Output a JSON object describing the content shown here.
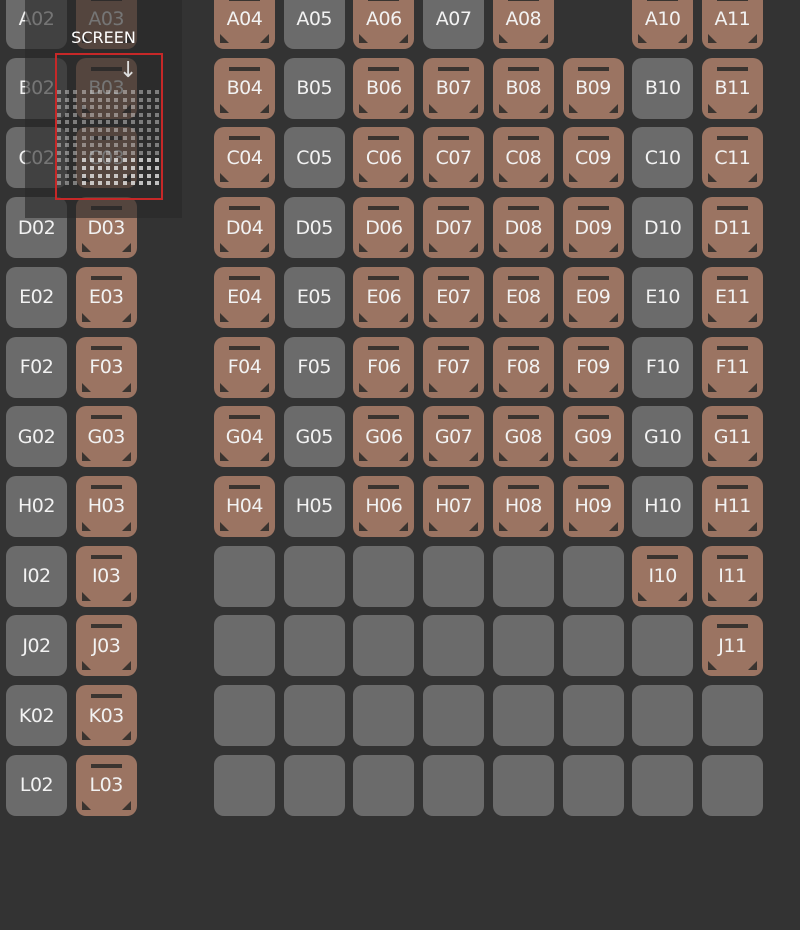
{
  "colors": {
    "background": "#333333",
    "available": "#6b6b6b",
    "booked": "#9b7462",
    "viewport_border": "#c62828"
  },
  "minimap": {
    "screen_label": "SCREEN",
    "arrow_icon": "arrow-down-icon"
  },
  "rows": [
    {
      "row": "A",
      "seats": [
        [
          "A02",
          "available"
        ],
        [
          "A03",
          "booked"
        ],
        [
          "A04",
          "booked"
        ],
        [
          "A05",
          "available"
        ],
        [
          "A06",
          "booked"
        ],
        [
          "A07",
          "available"
        ],
        [
          "A08",
          "booked"
        ],
        [
          "",
          "gap"
        ],
        [
          "A10",
          "booked"
        ],
        [
          "A11",
          "booked"
        ]
      ]
    },
    {
      "row": "B",
      "seats": [
        [
          "B02",
          "available"
        ],
        [
          "B03",
          "booked"
        ],
        [
          "B04",
          "booked"
        ],
        [
          "B05",
          "available"
        ],
        [
          "B06",
          "booked"
        ],
        [
          "B07",
          "booked"
        ],
        [
          "B08",
          "booked"
        ],
        [
          "B09",
          "booked"
        ],
        [
          "B10",
          "available"
        ],
        [
          "B11",
          "booked"
        ]
      ]
    },
    {
      "row": "C",
      "seats": [
        [
          "C02",
          "available"
        ],
        [
          "C03",
          "booked"
        ],
        [
          "C04",
          "booked"
        ],
        [
          "C05",
          "available"
        ],
        [
          "C06",
          "booked"
        ],
        [
          "C07",
          "booked"
        ],
        [
          "C08",
          "booked"
        ],
        [
          "C09",
          "booked"
        ],
        [
          "C10",
          "available"
        ],
        [
          "C11",
          "booked"
        ]
      ]
    },
    {
      "row": "D",
      "seats": [
        [
          "D02",
          "available"
        ],
        [
          "D03",
          "booked"
        ],
        [
          "D04",
          "booked"
        ],
        [
          "D05",
          "available"
        ],
        [
          "D06",
          "booked"
        ],
        [
          "D07",
          "booked"
        ],
        [
          "D08",
          "booked"
        ],
        [
          "D09",
          "booked"
        ],
        [
          "D10",
          "available"
        ],
        [
          "D11",
          "booked"
        ]
      ]
    },
    {
      "row": "E",
      "seats": [
        [
          "E02",
          "available"
        ],
        [
          "E03",
          "booked"
        ],
        [
          "E04",
          "booked"
        ],
        [
          "E05",
          "available"
        ],
        [
          "E06",
          "booked"
        ],
        [
          "E07",
          "booked"
        ],
        [
          "E08",
          "booked"
        ],
        [
          "E09",
          "booked"
        ],
        [
          "E10",
          "available"
        ],
        [
          "E11",
          "booked"
        ]
      ]
    },
    {
      "row": "F",
      "seats": [
        [
          "F02",
          "available"
        ],
        [
          "F03",
          "booked"
        ],
        [
          "F04",
          "booked"
        ],
        [
          "F05",
          "available"
        ],
        [
          "F06",
          "booked"
        ],
        [
          "F07",
          "booked"
        ],
        [
          "F08",
          "booked"
        ],
        [
          "F09",
          "booked"
        ],
        [
          "F10",
          "available"
        ],
        [
          "F11",
          "booked"
        ]
      ]
    },
    {
      "row": "G",
      "seats": [
        [
          "G02",
          "available"
        ],
        [
          "G03",
          "booked"
        ],
        [
          "G04",
          "booked"
        ],
        [
          "G05",
          "available"
        ],
        [
          "G06",
          "booked"
        ],
        [
          "G07",
          "booked"
        ],
        [
          "G08",
          "booked"
        ],
        [
          "G09",
          "booked"
        ],
        [
          "G10",
          "available"
        ],
        [
          "G11",
          "booked"
        ]
      ]
    },
    {
      "row": "H",
      "seats": [
        [
          "H02",
          "available"
        ],
        [
          "H03",
          "booked"
        ],
        [
          "H04",
          "booked"
        ],
        [
          "H05",
          "available"
        ],
        [
          "H06",
          "booked"
        ],
        [
          "H07",
          "booked"
        ],
        [
          "H08",
          "booked"
        ],
        [
          "H09",
          "booked"
        ],
        [
          "H10",
          "available"
        ],
        [
          "H11",
          "booked"
        ]
      ]
    },
    {
      "row": "I",
      "seats": [
        [
          "I02",
          "available"
        ],
        [
          "I03",
          "booked"
        ],
        [
          "",
          "empty"
        ],
        [
          "",
          "empty"
        ],
        [
          "",
          "empty"
        ],
        [
          "",
          "empty"
        ],
        [
          "",
          "empty"
        ],
        [
          "",
          "empty"
        ],
        [
          "I10",
          "booked"
        ],
        [
          "I11",
          "booked"
        ]
      ]
    },
    {
      "row": "J",
      "seats": [
        [
          "J02",
          "available"
        ],
        [
          "J03",
          "booked"
        ],
        [
          "",
          "empty"
        ],
        [
          "",
          "empty"
        ],
        [
          "",
          "empty"
        ],
        [
          "",
          "empty"
        ],
        [
          "",
          "empty"
        ],
        [
          "",
          "empty"
        ],
        [
          "",
          "empty"
        ],
        [
          "J11",
          "booked"
        ]
      ]
    },
    {
      "row": "K",
      "seats": [
        [
          "K02",
          "available"
        ],
        [
          "K03",
          "booked"
        ],
        [
          "",
          "empty"
        ],
        [
          "",
          "empty"
        ],
        [
          "",
          "empty"
        ],
        [
          "",
          "empty"
        ],
        [
          "",
          "empty"
        ],
        [
          "",
          "empty"
        ],
        [
          "",
          "empty"
        ],
        [
          "",
          "empty"
        ]
      ]
    },
    {
      "row": "L",
      "seats": [
        [
          "L02",
          "available"
        ],
        [
          "L03",
          "booked"
        ],
        [
          "",
          "empty"
        ],
        [
          "",
          "empty"
        ],
        [
          "",
          "empty"
        ],
        [
          "",
          "empty"
        ],
        [
          "",
          "empty"
        ],
        [
          "",
          "empty"
        ],
        [
          "",
          "empty"
        ],
        [
          "",
          "empty"
        ]
      ]
    }
  ]
}
